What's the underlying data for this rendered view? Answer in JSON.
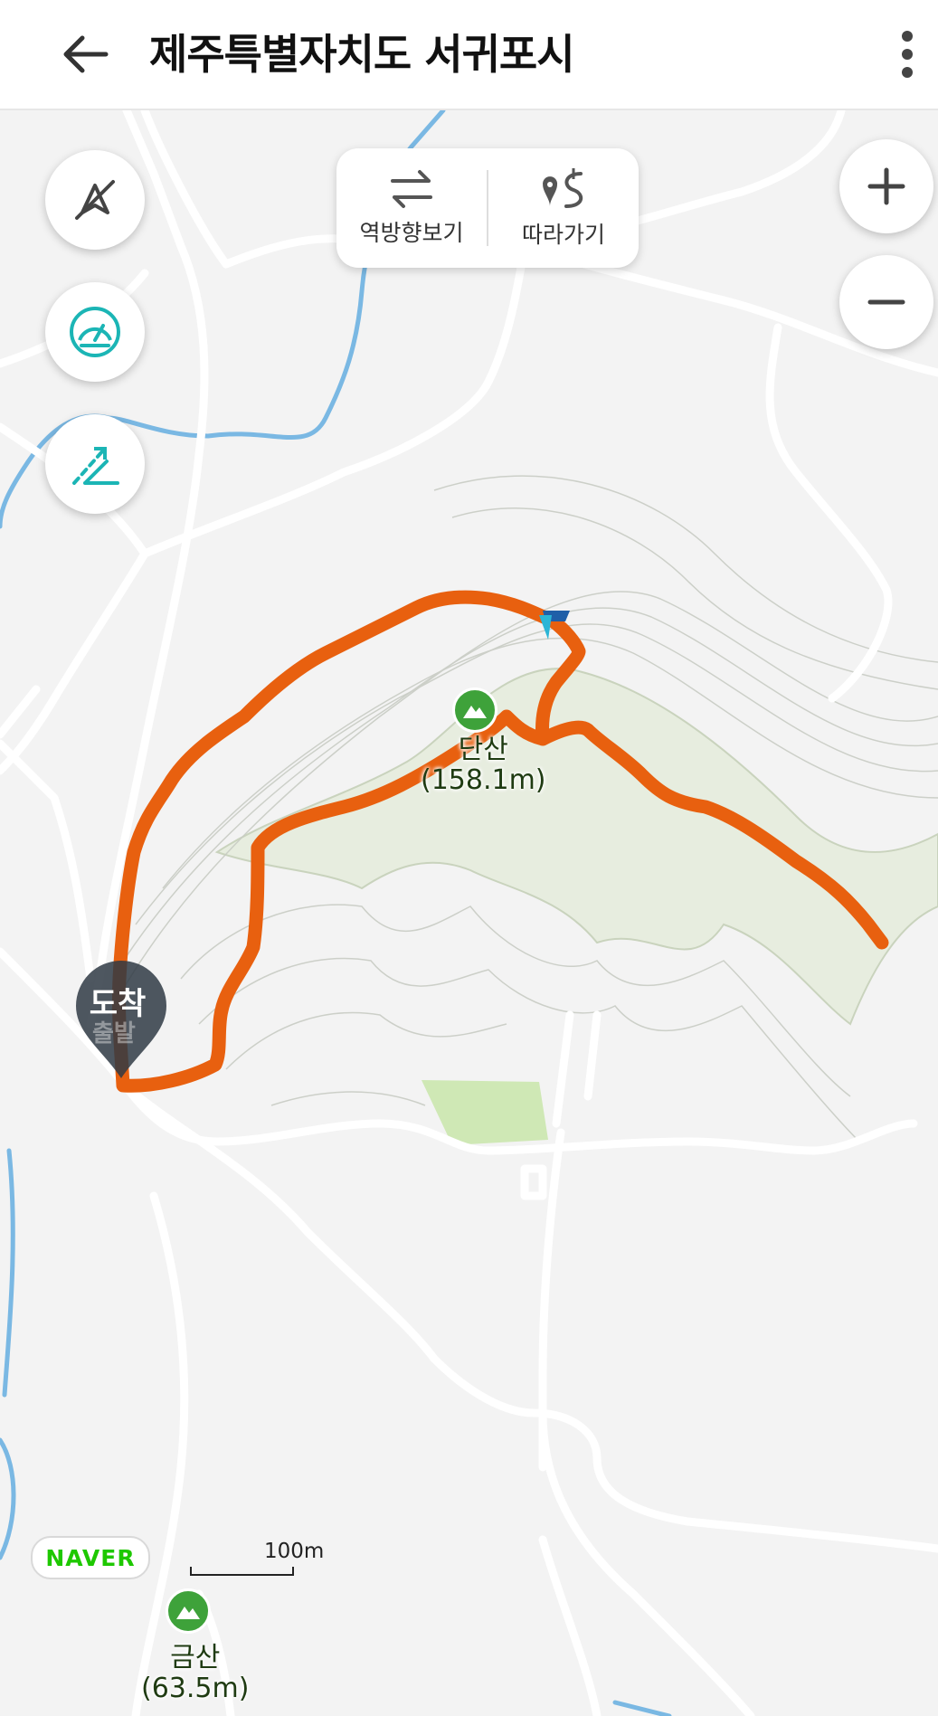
{
  "header": {
    "title": "제주특별자치도 서귀포시",
    "back_icon": "arrow-left-icon",
    "more_icon": "more-vertical-icon"
  },
  "controls": {
    "route_options": [
      {
        "label": "역방향보기",
        "icon": "swap-arrows-icon"
      },
      {
        "label": "따라가기",
        "icon": "route-follow-icon"
      }
    ],
    "left_buttons": [
      "compass-off-icon",
      "speedometer-icon",
      "slope-icon"
    ],
    "zoom_in_icon": "plus-icon",
    "zoom_out_icon": "minus-icon"
  },
  "map": {
    "peaks": [
      {
        "name": "단산",
        "elevation": "(158.1m)"
      },
      {
        "name": "금산",
        "elevation": "(63.5m)"
      }
    ],
    "markers": {
      "arrival": "도착",
      "departure": "출발"
    },
    "scale_label": "100m",
    "brand": "NAVER",
    "colors": {
      "track": "#e8600f",
      "road": "#ffffff",
      "water": "#7ab8e3",
      "forest": "#e4ecd9",
      "park": "#cfe8b5",
      "peak_icon": "#3ea23a"
    }
  }
}
